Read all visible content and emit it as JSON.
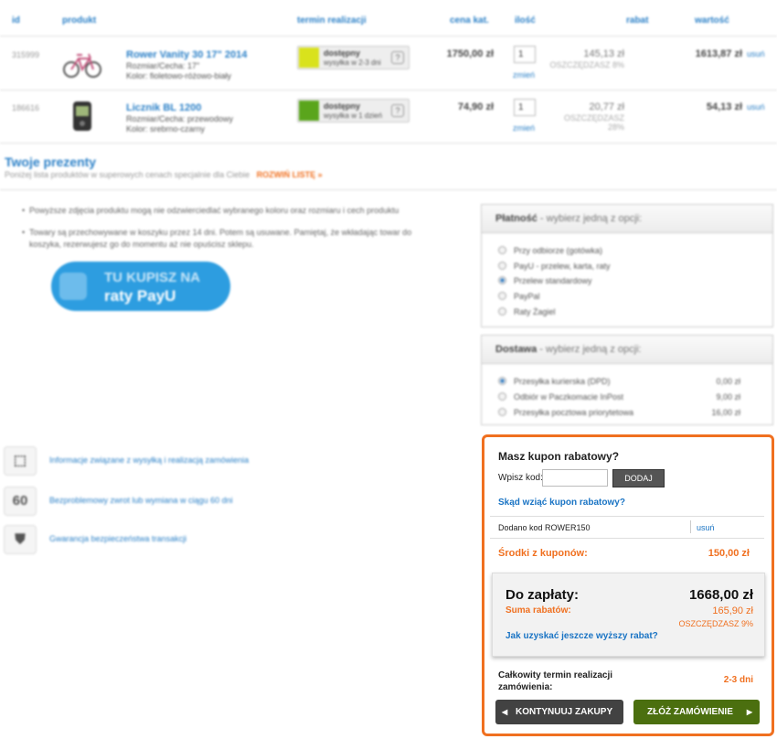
{
  "table": {
    "headers": [
      "id",
      "produkt",
      "termin realizacji",
      "cena kat.",
      "ilość",
      "rabat",
      "wartość"
    ],
    "rows": [
      {
        "id": "315999",
        "name": "Rower Vanity 30 17\" 2014",
        "attr1": "Rozmiar/Cecha: 17\"",
        "attr2": "Kolor: fioletowo-różowo-biały",
        "avail_status": "dostępny",
        "avail_time": "wysyłka w 2-3 dni",
        "avail_color": "#d9e21c",
        "price": "1750,00 zł",
        "qty": "1",
        "change": "zmień",
        "discount": "145,13 zł",
        "save": "OSZCZĘDZASZ 8%",
        "value": "1613,87 zł",
        "delete": "usuń"
      },
      {
        "id": "186616",
        "name": "Licznik BL 1200",
        "attr1": "Rozmiar/Cecha: przewodowy",
        "attr2": "Kolor: srebrno-czarny",
        "avail_status": "dostępny",
        "avail_time": "wysyłka w 1 dzień",
        "avail_color": "#5aa51c",
        "price": "74,90 zł",
        "qty": "1",
        "change": "zmień",
        "discount": "20,77 zł",
        "save": "OSZCZĘDZASZ 28%",
        "value": "54,13 zł",
        "delete": "usuń"
      }
    ]
  },
  "gifts": {
    "title": "Twoje prezenty",
    "subtitle": "Poniżej lista produktów w superowych cenach specjalnie dla Ciebie",
    "link": "ROZWIŃ LISTĘ »"
  },
  "notes": [
    "Powyższe zdjęcia produktu mogą nie odzwierciedlać wybranego koloru oraz rozmiaru i cech produktu",
    "Towary są przechowywane w koszyku przez 14 dni. Potem są usuwane. Pamiętaj, że wkładając towar do koszyka, rezerwujesz go do momentu aż nie opuścisz sklepu."
  ],
  "raty": {
    "line1": "TU KUPISZ NA",
    "line2": "raty PayU"
  },
  "payment": {
    "title": "Płatność",
    "hint": " - wybierz jedną z opcji:",
    "options": [
      "Przy odbiorze (gotówka)",
      "PayU - przelew, karta, raty",
      "Przelew standardowy",
      "PayPal",
      "Raty Żagiel"
    ],
    "selected": 2
  },
  "shipping": {
    "title": "Dostawa",
    "hint": " - wybierz jedną z opcji:",
    "options": [
      {
        "label": "Przesyłka kurierska (DPD)",
        "price": "0,00 zł"
      },
      {
        "label": "Odbiór w Paczkomacie InPost",
        "price": "9,00 zł"
      },
      {
        "label": "Przesyłka pocztowa priorytetowa",
        "price": "16,00 zł"
      }
    ],
    "selected": 0
  },
  "info": [
    {
      "icon": "box-icon",
      "glyph": "⬚",
      "text": "Informacje związane z wysyłką i realizacją zamówienia"
    },
    {
      "icon": "return-60-icon",
      "glyph": "60",
      "text": "Bezproblemowy zwrot lub wymiana w ciągu 60 dni"
    },
    {
      "icon": "shield-icon",
      "glyph": "⛊",
      "text": "Gwarancja bezpieczeństwa transakcji"
    }
  ],
  "coupon": {
    "title": "Masz kupon rabatowy?",
    "label": "Wpisz kod:",
    "input_value": "",
    "button": "DODAJ",
    "where": "Skąd wziąć kupon rabatowy?",
    "added": "Dodano kod ROWER150",
    "delete": "usuń",
    "funds_label": "Środki z kuponów:",
    "funds_value": "150,00 zł"
  },
  "summary": {
    "pay_label": "Do zapłaty:",
    "pay_value": "1668,00 zł",
    "disc_label": "Suma rabatów:",
    "disc_value": "165,90 zł",
    "save": "OSZCZĘDZASZ 9%",
    "how": "Jak uzyskać jeszcze wyższy rabat?",
    "term_label": "Całkowity termin realizacji zamówienia:",
    "term_value": "2-3 dni",
    "continue_button": "KONTYNUUJ ZAKUPY",
    "order_button": "ZŁÓŻ ZAMÓWIENIE"
  },
  "colors": {
    "accent_orange": "#f07020",
    "link_blue": "#1a74c4",
    "order_green": "#4b6f0f"
  }
}
